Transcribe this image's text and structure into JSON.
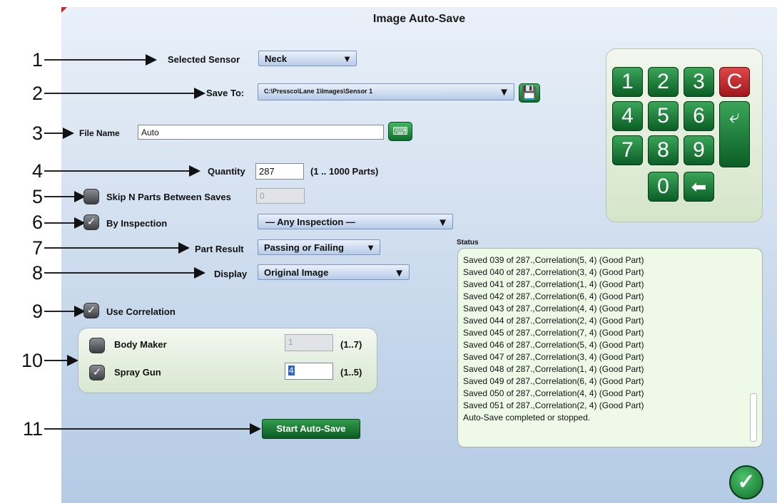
{
  "window": {
    "title": "Image Auto-Save"
  },
  "callouts": [
    "1",
    "2",
    "3",
    "4",
    "5",
    "6",
    "7",
    "8",
    "9",
    "10",
    "11"
  ],
  "form": {
    "sensor_label": "Selected Sensor",
    "sensor_value": "Neck",
    "save_to_label": "Save To:",
    "save_to_value": "C:\\Pressco\\Lane 1\\Images\\Sensor 1",
    "file_name_label": "File Name",
    "file_name_value": "Auto",
    "quantity_label": "Quantity",
    "quantity_value": "287",
    "quantity_range": "(1 .. 1000 Parts)",
    "skip_label": "Skip N Parts Between Saves",
    "skip_value": "0",
    "skip_checked": false,
    "by_inspection_label": "By Inspection",
    "by_inspection_checked": true,
    "inspection_value": "— Any Inspection —",
    "part_result_label": "Part Result",
    "part_result_value": "Passing or Failing",
    "display_label": "Display",
    "display_value": "Original Image",
    "use_correlation_label": "Use Correlation",
    "use_correlation_checked": true,
    "body_maker_label": "Body Maker",
    "body_maker_value": "1",
    "body_maker_range": "(1..7)",
    "body_maker_checked": false,
    "spray_gun_label": "Spray Gun",
    "spray_gun_value": "4",
    "spray_gun_range": "(1..5)",
    "spray_gun_checked": true,
    "start_button": "Start Auto-Save"
  },
  "numpad": {
    "keys": [
      "1",
      "2",
      "3",
      "C",
      "4",
      "5",
      "6",
      "7",
      "8",
      "9",
      "0"
    ]
  },
  "status": {
    "label": "Status",
    "lines": [
      "Saved 039 of 287.,Correlation(5, 4) (Good Part)",
      "Saved 040 of 287.,Correlation(3, 4) (Good Part)",
      "Saved 041 of 287.,Correlation(1, 4) (Good Part)",
      "Saved 042 of 287.,Correlation(6, 4) (Good Part)",
      "Saved 043 of 287.,Correlation(4, 4) (Good Part)",
      "Saved 044 of 287.,Correlation(2, 4) (Good Part)",
      "Saved 045 of 287.,Correlation(7, 4) (Good Part)",
      "Saved 046 of 287.,Correlation(5, 4) (Good Part)",
      "Saved 047 of 287.,Correlation(3, 4) (Good Part)",
      "Saved 048 of 287.,Correlation(1, 4) (Good Part)",
      "Saved 049 of 287.,Correlation(6, 4) (Good Part)",
      "Saved 050 of 287.,Correlation(4, 4) (Good Part)",
      "Saved 051 of 287.,Correlation(2, 4) (Good Part)",
      "Auto-Save completed or stopped."
    ]
  },
  "icons": {
    "save": "floppy-disk-icon",
    "keyboard": "keyboard-icon",
    "enter": "enter-arrow-icon",
    "backspace": "backspace-arrow-icon",
    "ok": "checkmark-icon",
    "dropdown": "dropdown-triangle-icon"
  },
  "colors": {
    "accent_green": "#0e6f2c",
    "clear_red": "#c0282d",
    "panel_blue": "#c0d3e9"
  }
}
